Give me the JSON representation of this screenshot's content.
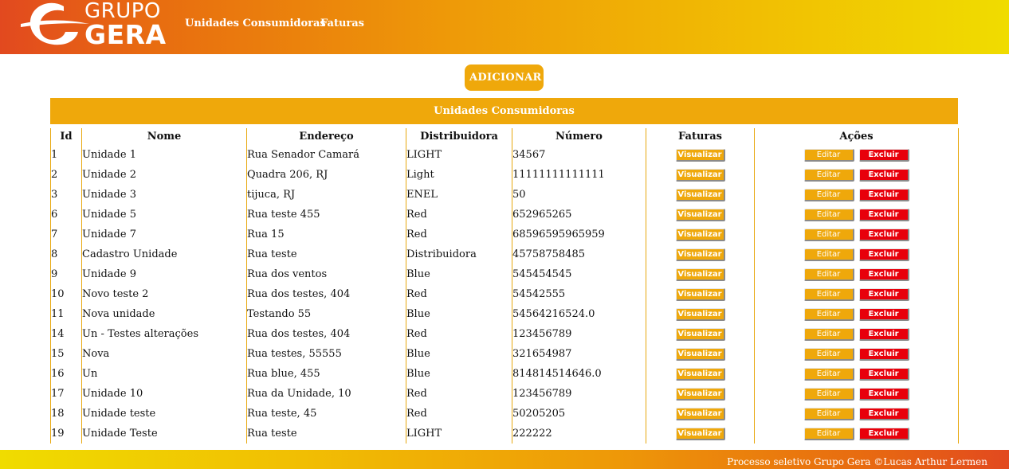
{
  "brand": {
    "line1": "GRUPO",
    "line2": "GERA"
  },
  "nav": {
    "consumer_units": "Unidades Consumidoras",
    "invoices": "Faturas"
  },
  "actions": {
    "add_label": "ADICIONAR"
  },
  "table": {
    "title": "Unidades Consumidoras",
    "columns": {
      "id": "Id",
      "name": "Nome",
      "address": "Endereço",
      "distributor": "Distribuidora",
      "number": "Número",
      "invoices": "Faturas",
      "actions": "Ações"
    },
    "button_labels": {
      "view": "Visualizar",
      "edit": "Editar",
      "delete": "Excluir"
    },
    "rows": [
      {
        "id": "1",
        "name": "Unidade 1",
        "address": "Rua Senador Camará",
        "distributor": "LIGHT",
        "number": "34567"
      },
      {
        "id": "2",
        "name": "Unidade 2",
        "address": "Quadra 206, RJ",
        "distributor": "Light",
        "number": "11111111111111"
      },
      {
        "id": "3",
        "name": "Unidade 3",
        "address": "tijuca, RJ",
        "distributor": "ENEL",
        "number": "50"
      },
      {
        "id": "6",
        "name": "Unidade 5",
        "address": "Rua teste 455",
        "distributor": "Red",
        "number": "652965265"
      },
      {
        "id": "7",
        "name": "Unidade 7",
        "address": "Rua 15",
        "distributor": "Red",
        "number": "68596595965959"
      },
      {
        "id": "8",
        "name": "Cadastro Unidade",
        "address": "Rua teste",
        "distributor": "Distribuidora",
        "number": "45758758485"
      },
      {
        "id": "9",
        "name": "Unidade 9",
        "address": "Rua dos ventos",
        "distributor": "Blue",
        "number": "545454545"
      },
      {
        "id": "10",
        "name": "Novo teste 2",
        "address": "Rua dos testes, 404",
        "distributor": "Red",
        "number": "54542555"
      },
      {
        "id": "11",
        "name": "Nova unidade",
        "address": "Testando 55",
        "distributor": "Blue",
        "number": "54564216524.0"
      },
      {
        "id": "14",
        "name": "Un - Testes alterações",
        "address": "Rua dos testes, 404",
        "distributor": "Red",
        "number": "123456789"
      },
      {
        "id": "15",
        "name": "Nova",
        "address": "Rua testes, 55555",
        "distributor": "Blue",
        "number": "321654987"
      },
      {
        "id": "16",
        "name": "Un",
        "address": "Rua blue, 455",
        "distributor": "Blue",
        "number": "814814514646.0"
      },
      {
        "id": "17",
        "name": "Unidade 10",
        "address": "Rua da Unidade, 10",
        "distributor": "Red",
        "number": "123456789"
      },
      {
        "id": "18",
        "name": "Unidade teste",
        "address": "Rua teste, 45",
        "distributor": "Red",
        "number": "50205205"
      },
      {
        "id": "19",
        "name": "Unidade Teste",
        "address": "Rua teste",
        "distributor": "LIGHT",
        "number": "222222"
      }
    ]
  },
  "footer": {
    "text": "Processo seletivo Grupo Gera ©Lucas Arthur Lermen"
  },
  "colors": {
    "accent": "#efa80b",
    "danger": "#e8000b",
    "header_start": "#e2491f",
    "header_end": "#f0dc00"
  },
  "icons": {
    "logo": "gera-swoosh-logo"
  }
}
